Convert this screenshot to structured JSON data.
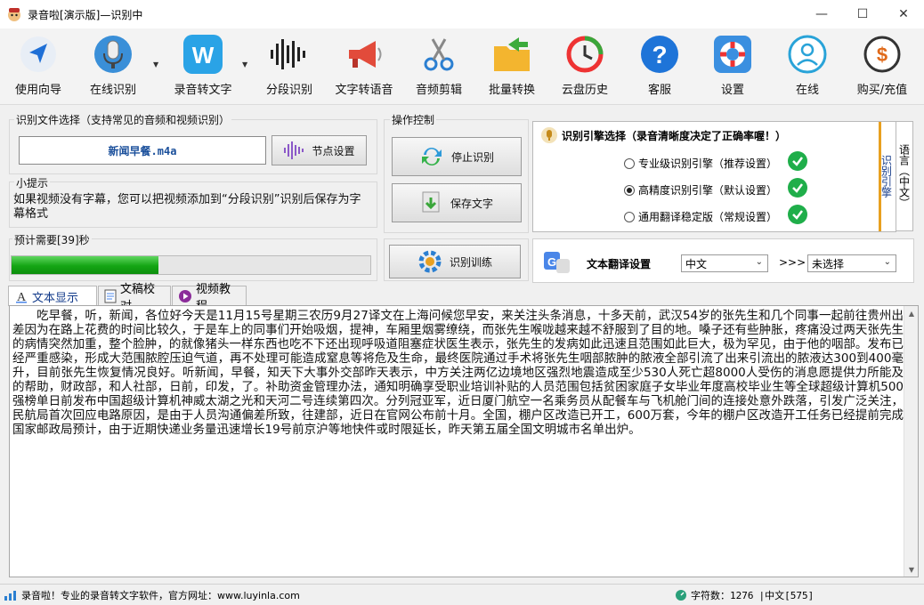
{
  "window": {
    "title": "录音啦[演示版]—识别中",
    "minimize": "—",
    "maximize": "☐",
    "close": "✕"
  },
  "toolbar": [
    {
      "label": "使用向导",
      "icon": "navigation-arrow-icon"
    },
    {
      "label": "在线识别",
      "icon": "microphone-icon"
    },
    {
      "label": "录音转文字",
      "icon": "w-letter-icon"
    },
    {
      "label": "分段识别",
      "icon": "waveform-icon"
    },
    {
      "label": "文字转语音",
      "icon": "megaphone-icon"
    },
    {
      "label": "音频剪辑",
      "icon": "scissors-icon"
    },
    {
      "label": "批量转换",
      "icon": "folder-arrow-icon"
    },
    {
      "label": "云盘历史",
      "icon": "history-clock-icon"
    },
    {
      "label": "客服",
      "icon": "question-icon"
    },
    {
      "label": "设置",
      "icon": "lifebuoy-icon"
    },
    {
      "label": "在线",
      "icon": "user-online-icon"
    },
    {
      "label": "购买/充值",
      "icon": "dollar-coin-icon"
    }
  ],
  "file_select": {
    "title": "识别文件选择（支持常见的音频和视频识别）",
    "filename": "新闻早餐.m4a",
    "node_button": "节点设置"
  },
  "tip": {
    "title": "小提示",
    "text": "如果视频没有字幕，您可以把视频添加到“分段识别”识别后保存为字幕格式"
  },
  "progress": {
    "label": "预计需要[39]秒",
    "fraction": 0.41
  },
  "controls": {
    "title": "操作控制",
    "stop": "停止识别",
    "save": "保存文字",
    "train": "识别训练"
  },
  "engine": {
    "title": "识别引擎选择（录音清晰度决定了正确率喔！）",
    "options": [
      {
        "label": "专业级识别引擎（推荐设置）",
        "selected": false
      },
      {
        "label": "高精度识别引擎（默认设置）",
        "selected": true
      },
      {
        "label": "通用翻译稳定版（常规设置）",
        "selected": false
      }
    ],
    "side_tab_a": "识别引擎",
    "side_tab_b": "语言（中文）"
  },
  "translate": {
    "label": "文本翻译设置",
    "from": "中文",
    "separator": ">>>",
    "to": "未选择"
  },
  "tabs": [
    {
      "label": "文本显示",
      "active": true
    },
    {
      "label": "文稿校对",
      "active": false
    },
    {
      "label": "视频教程",
      "active": false
    }
  ],
  "transcript": "吃早餐，听，新闻，各位好今天是11月15号星期三农历9月27译文在上海问候您早安，来关注头条消息，十多天前，武汉54岁的张先生和几个同事一起前往贵州出差因为在路上花费的时间比较久，于是车上的同事们开始吸烟，提神，车厢里烟雾缭绕，而张先生喉咙越来越不舒服到了目的地。嗓子还有些肿胀，疼痛没过两天张先生的病情突然加重，整个脸肿，的就像猪头一样东西也吃不下还出现呼吸道阻塞症状医生表示，张先生的发病如此迅速且范围如此巨大，极为罕见，由于他的咽部。发布已经严重感染，形成大范围脓腔压迫气道，再不处理可能造成窒息等将危及生命，最终医院通过手术将张先生咽部脓肿的脓液全部引流了出来引流出的脓液达300到400毫升，目前张先生恢复情况良好。听新闻，早餐，知天下大事外交部昨天表示，中方关注两亿边境地区强烈地震造成至少530人死亡超8000人受伤的消息愿提供力所能及的帮助，财政部，和人社部，日前，印发，了。补助资金管理办法，通知明确享受职业培训补贴的人员范围包括贫困家庭子女毕业年度高校毕业生等全球超级计算机500强榜单日前发布中国超级计算机神威太湖之光和天河二号连续第四次。分列冠亚军，近日厦门航空一名乘务员从配餐车与飞机舱门间的连接处意外跌落，引发广泛关注，民航局首次回应电路原因，是由于人员沟通偏差所致，往建部，近日在官网公布前十月。全国，棚户区改造已开工，600万套，今年的棚户区改造开工任务已经提前完成国家邮政局预计，由于近期快递业务量迅速增长19号前京沪等地快件或时限延长，昨天第五届全国文明城市名单出炉。",
  "statusbar": {
    "left": "录音啦！专业的录音转文字软件，官方网址：www.luyinla.com",
    "char_count": "字符数：1276",
    "language": "|中文[575]"
  },
  "colors": {
    "progress": "#14a514",
    "check": "#1fae4a",
    "accent_blue": "#1a4f9b"
  }
}
